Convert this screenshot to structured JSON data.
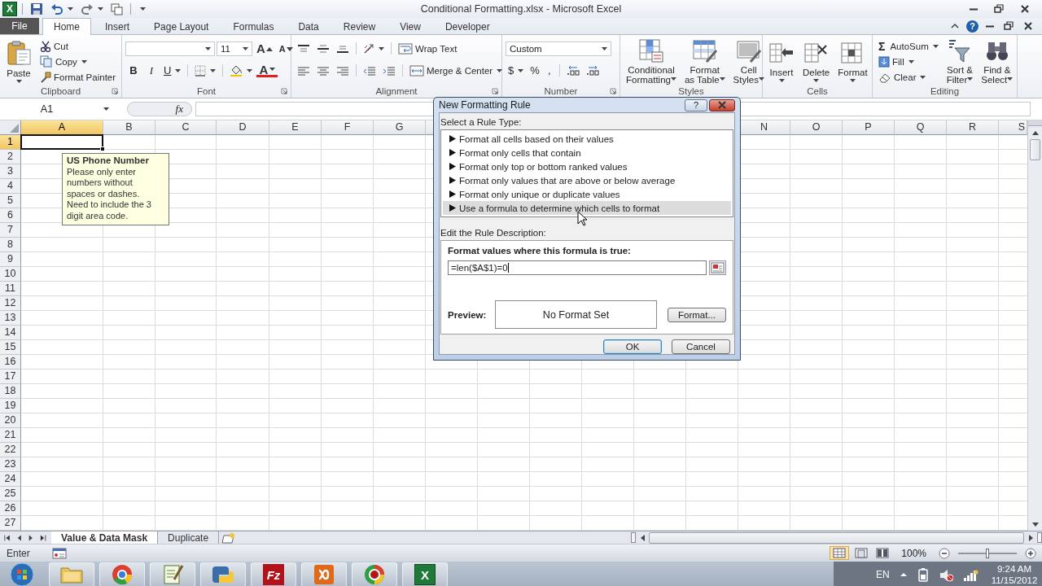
{
  "window": {
    "app_glyph": "X",
    "title": "Conditional Formatting.xlsx - Microsoft Excel"
  },
  "tabs": [
    {
      "label": "File",
      "kind": "file",
      "selected": false
    },
    {
      "label": "Home",
      "kind": "tab",
      "selected": true
    },
    {
      "label": "Insert",
      "kind": "tab",
      "selected": false
    },
    {
      "label": "Page Layout",
      "kind": "tab",
      "selected": false
    },
    {
      "label": "Formulas",
      "kind": "tab",
      "selected": false
    },
    {
      "label": "Data",
      "kind": "tab",
      "selected": false
    },
    {
      "label": "Review",
      "kind": "tab",
      "selected": false
    },
    {
      "label": "View",
      "kind": "tab",
      "selected": false
    },
    {
      "label": "Developer",
      "kind": "tab",
      "selected": false
    }
  ],
  "help_glyph": "?",
  "ribbon": {
    "clipboard": {
      "paste": "Paste",
      "cut": "Cut",
      "copy": "Copy",
      "format_painter": "Format Painter",
      "label": "Clipboard"
    },
    "font": {
      "size": "11",
      "grow_font": "A",
      "shrink_font": "A",
      "bold": "B",
      "italic": "I",
      "underline": "U",
      "font_color": "A",
      "label": "Font"
    },
    "alignment": {
      "wrap_text": "Wrap Text",
      "merge_center": "Merge & Center",
      "label": "Alignment"
    },
    "number": {
      "format": "Custom",
      "currency": "$",
      "percent": "%",
      "comma": ",",
      "label": "Number"
    },
    "styles": {
      "conditional_formatting": "Conditional\nFormatting",
      "format_as_table": "Format\nas Table",
      "cell_styles": "Cell\nStyles",
      "label": "Styles"
    },
    "cells": {
      "insert": "Insert",
      "delete": "Delete",
      "format": "Format",
      "label": "Cells"
    },
    "editing": {
      "autosum_glyph": "Σ",
      "autosum": "AutoSum",
      "fill": "Fill",
      "clear": "Clear",
      "sort_filter": "Sort &\nFilter",
      "find_select": "Find &\nSelect",
      "label": "Editing"
    }
  },
  "formula_bar": {
    "name_box": "A1",
    "function_glyph": "fx"
  },
  "sheet": {
    "columns": [
      {
        "label": "A",
        "selected": true
      },
      {
        "label": "B",
        "selected": false
      },
      {
        "label": "C",
        "selected": false
      },
      {
        "label": "D",
        "selected": false
      },
      {
        "label": "E",
        "selected": false
      },
      {
        "label": "F",
        "selected": false
      },
      {
        "label": "G",
        "selected": false
      },
      {
        "label": "N",
        "selected": false
      },
      {
        "label": "O",
        "selected": false
      },
      {
        "label": "P",
        "selected": false
      },
      {
        "label": "Q",
        "selected": false
      },
      {
        "label": "R",
        "selected": false
      },
      {
        "label": "S",
        "selected": false
      }
    ],
    "rows": [
      {
        "label": "1",
        "selected": true
      },
      {
        "label": "2",
        "selected": false
      },
      {
        "label": "3",
        "selected": false
      },
      {
        "label": "4",
        "selected": false
      },
      {
        "label": "5",
        "selected": false
      },
      {
        "label": "6",
        "selected": false
      },
      {
        "label": "7",
        "selected": false
      },
      {
        "label": "8",
        "selected": false
      },
      {
        "label": "9",
        "selected": false
      },
      {
        "label": "10",
        "selected": false
      },
      {
        "label": "11",
        "selected": false
      },
      {
        "label": "12",
        "selected": false
      },
      {
        "label": "13",
        "selected": false
      },
      {
        "label": "14",
        "selected": false
      },
      {
        "label": "15",
        "selected": false
      },
      {
        "label": "16",
        "selected": false
      },
      {
        "label": "17",
        "selected": false
      },
      {
        "label": "18",
        "selected": false
      },
      {
        "label": "19",
        "selected": false
      },
      {
        "label": "20",
        "selected": false
      },
      {
        "label": "21",
        "selected": false
      },
      {
        "label": "22",
        "selected": false
      },
      {
        "label": "23",
        "selected": false
      },
      {
        "label": "24",
        "selected": false
      },
      {
        "label": "25",
        "selected": false
      },
      {
        "label": "26",
        "selected": false
      },
      {
        "label": "27",
        "selected": false
      }
    ]
  },
  "validation_tip": {
    "title": "US Phone Number",
    "message": "Please only enter numbers without spaces or dashes. Need to include the 3 digit area code."
  },
  "sheet_tabs": [
    {
      "label": "Value & Data Mask",
      "selected": true
    },
    {
      "label": "Duplicate",
      "selected": false
    }
  ],
  "status_bar": {
    "mode": "Enter",
    "zoom": "100%",
    "zoom_slider": {
      "level": 0.5
    }
  },
  "dialog": {
    "title": "New Formatting Rule",
    "help_glyph": "?",
    "rule_type_label": "Select a Rule Type:",
    "rule_types": [
      {
        "label": "Format all cells based on their values",
        "selected": false
      },
      {
        "label": "Format only cells that contain",
        "selected": false
      },
      {
        "label": "Format only top or bottom ranked values",
        "selected": false
      },
      {
        "label": "Format only values that are above or below average",
        "selected": false
      },
      {
        "label": "Format only unique or duplicate values",
        "selected": false
      },
      {
        "label": "Use a formula to determine which cells to format",
        "selected": true
      }
    ],
    "description_label": "Edit the Rule Description:",
    "formula_label": "Format values where this formula is true:",
    "formula": "=len($A$1)=0",
    "preview_label": "Preview:",
    "preview": "No Format Set",
    "format_button": "Format...",
    "ok_button": "OK",
    "cancel_button": "Cancel"
  },
  "taskbar": {
    "apps": [
      {
        "kind": "folder"
      },
      {
        "kind": "browser"
      },
      {
        "kind": "editor"
      },
      {
        "kind": "python"
      },
      {
        "kind": "ftp",
        "glyph": "Fz"
      },
      {
        "kind": "server"
      },
      {
        "kind": "browser_alt"
      },
      {
        "kind": "spreadsheet",
        "glyph": "X"
      }
    ],
    "language": "EN",
    "time": "9:24 AM",
    "date": "11/15/2012"
  }
}
